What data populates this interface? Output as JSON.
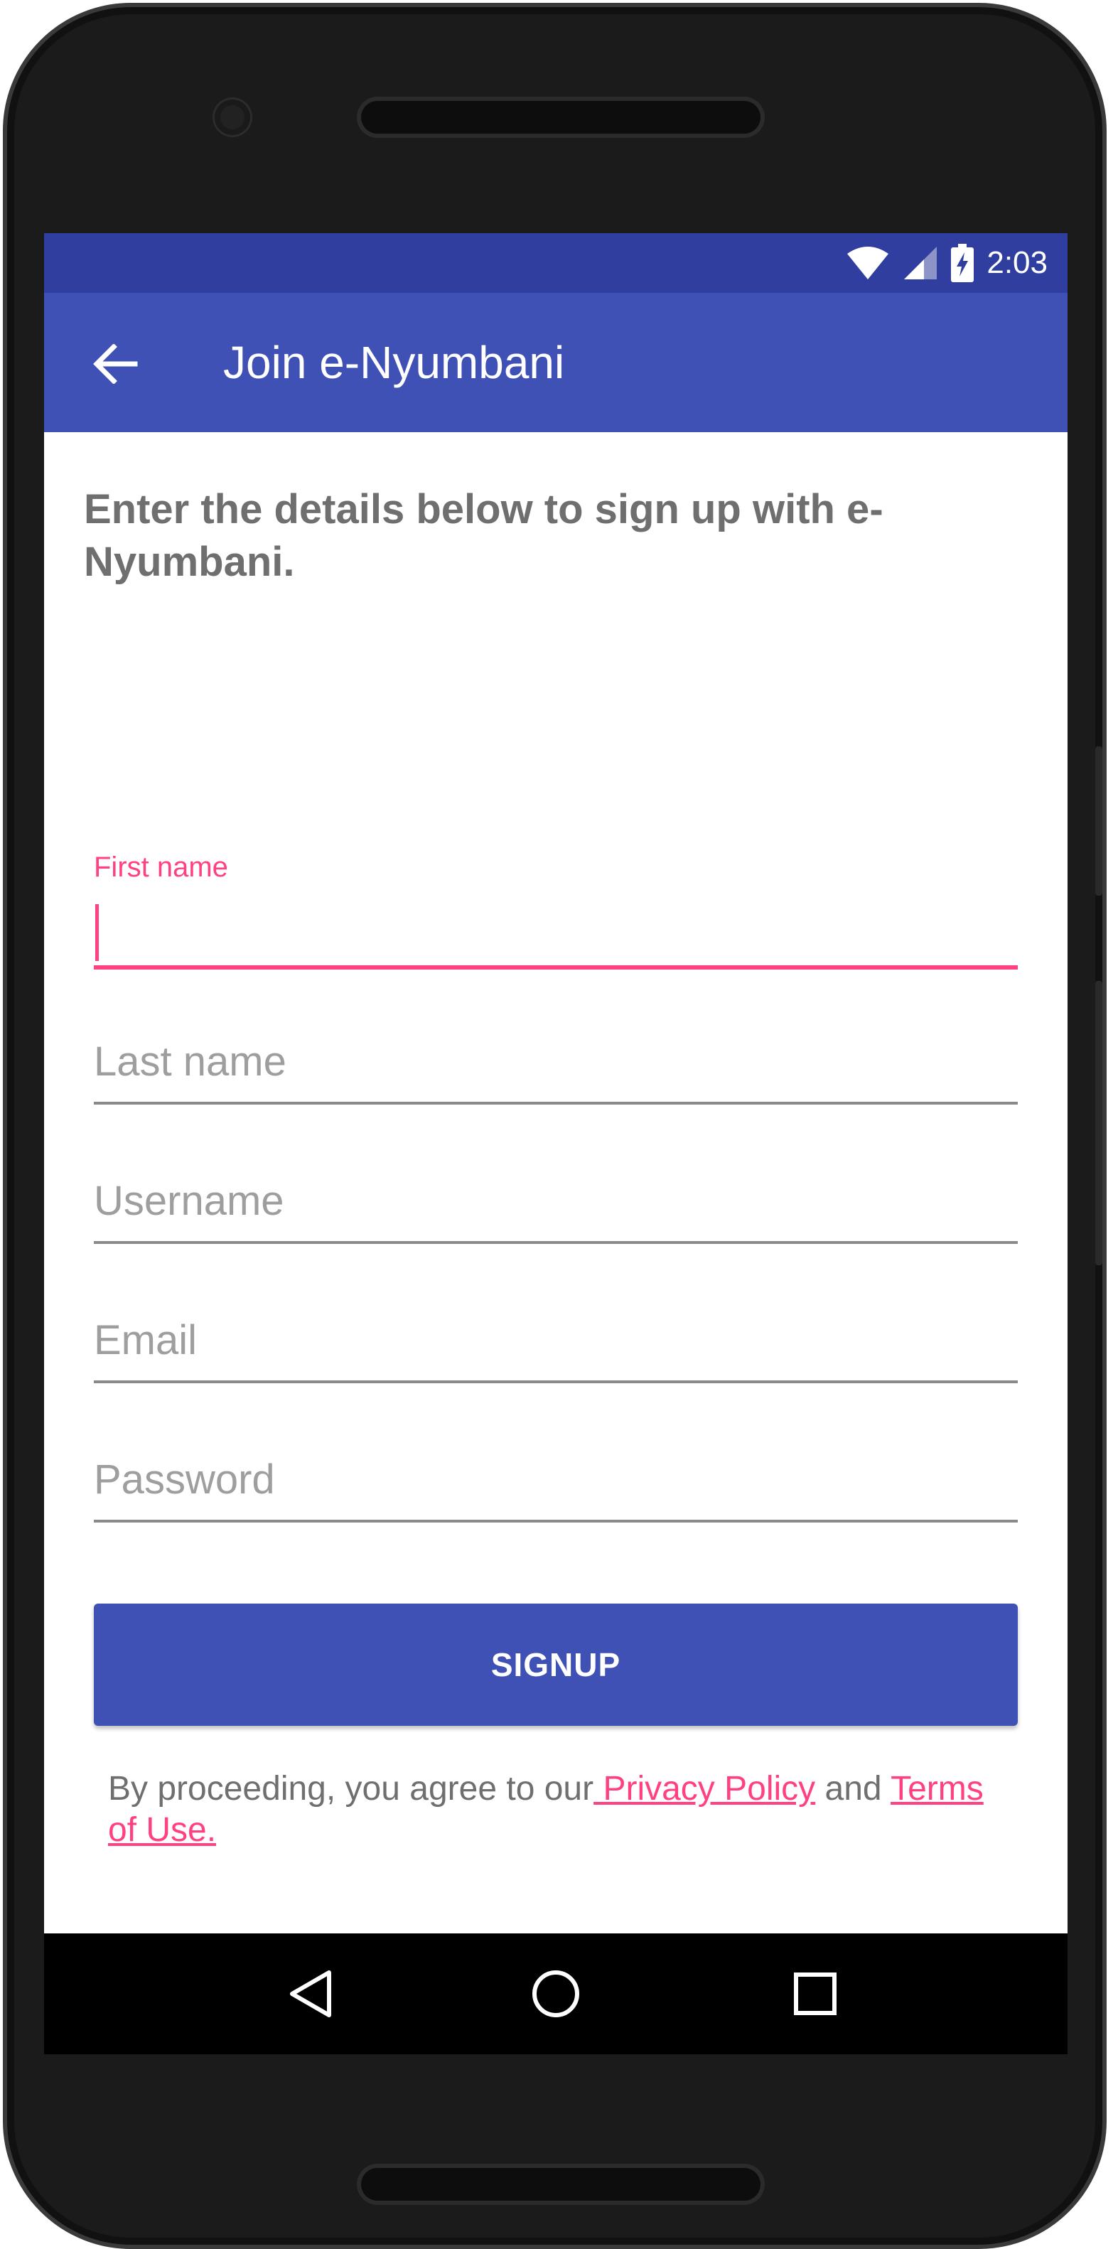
{
  "status_bar": {
    "time": "2:03",
    "icons": [
      "wifi-icon",
      "cellular-signal-icon",
      "battery-charging-icon"
    ]
  },
  "app_bar": {
    "title": "Join e-Nyumbani",
    "back_icon": "arrow-back-icon"
  },
  "form": {
    "intro": "Enter the details below to sign up with e-Nyumbani.",
    "first_name": {
      "label": "First name",
      "value": ""
    },
    "last_name": {
      "placeholder": "Last name",
      "value": ""
    },
    "username": {
      "placeholder": "Username",
      "value": ""
    },
    "email": {
      "placeholder": "Email",
      "value": ""
    },
    "password": {
      "placeholder": "Password",
      "value": ""
    },
    "signup_label": "SIGNUP"
  },
  "terms": {
    "prefix": "By proceeding, you agree to our",
    "privacy_link": " Privacy Policy",
    "and": " and ",
    "terms_link": "Terms of Use."
  },
  "nav_bar": {
    "icons": [
      "back-triangle-icon",
      "home-circle-icon",
      "recents-square-icon"
    ]
  },
  "colors": {
    "status_bar": "#303f9f",
    "primary": "#3f51b5",
    "accent": "#ff4081",
    "text_secondary": "#6f6f6f",
    "hint": "#9e9e9e"
  }
}
